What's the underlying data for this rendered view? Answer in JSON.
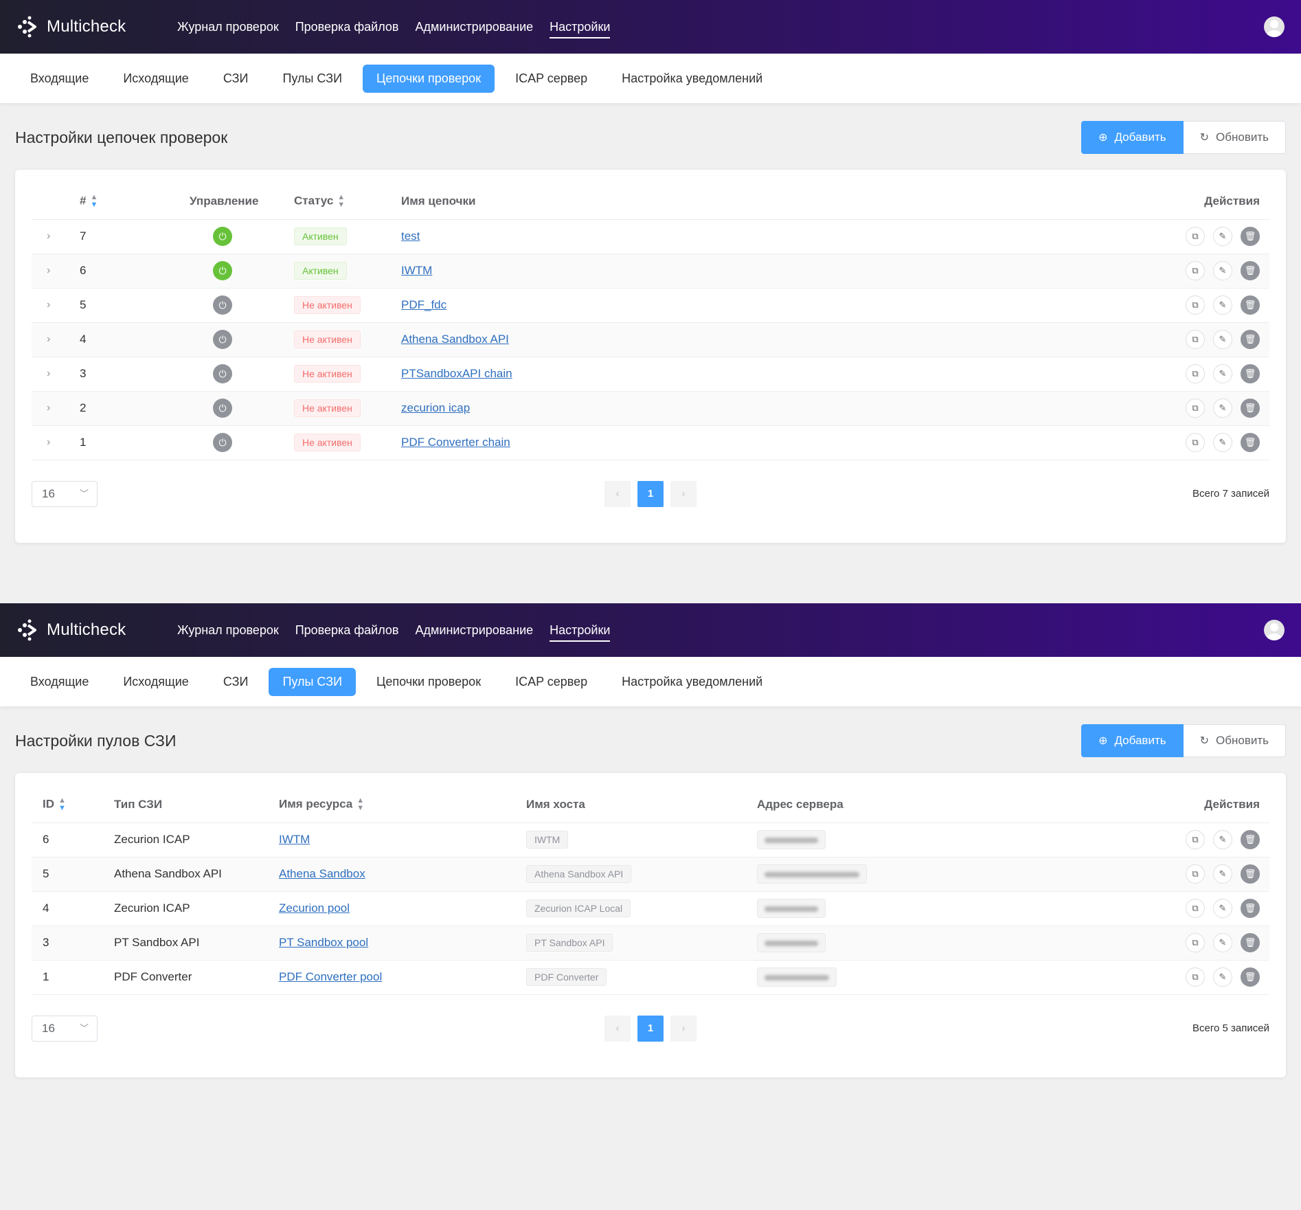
{
  "app": {
    "name": "Multicheck",
    "nav": [
      "Журнал проверок",
      "Проверка файлов",
      "Администрирование",
      "Настройки"
    ],
    "subnav": [
      "Входящие",
      "Исходящие",
      "СЗИ",
      "Пулы СЗИ",
      "Цепочки проверок",
      "ICAP сервер",
      "Настройка уведомлений"
    ],
    "add_label": "Добавить",
    "refresh_label": "Обновить"
  },
  "chains": {
    "active_tab": "Цепочки проверок",
    "title": "Настройки цепочек проверок",
    "columns": [
      "#",
      "Управление",
      "Статус",
      "Имя цепочки",
      "Действия"
    ],
    "rows": [
      {
        "id": "7",
        "enabled": true,
        "status": "Активен",
        "name": "test"
      },
      {
        "id": "6",
        "enabled": true,
        "status": "Активен",
        "name": "IWTM"
      },
      {
        "id": "5",
        "enabled": false,
        "status": "Не активен",
        "name": "PDF_fdc"
      },
      {
        "id": "4",
        "enabled": false,
        "status": "Не активен",
        "name": "Athena Sandbox API"
      },
      {
        "id": "3",
        "enabled": false,
        "status": "Не активен",
        "name": "PTSandboxAPI chain"
      },
      {
        "id": "2",
        "enabled": false,
        "status": "Не активен",
        "name": "zecurion icap"
      },
      {
        "id": "1",
        "enabled": false,
        "status": "Не активен",
        "name": "PDF Converter chain"
      }
    ],
    "page_size": "16",
    "current_page": "1",
    "total": "Всего 7 записей"
  },
  "pools": {
    "active_tab": "Пулы СЗИ",
    "title": "Настройки пулов СЗИ",
    "columns": [
      "ID",
      "Тип СЗИ",
      "Имя ресурса",
      "Имя хоста",
      "Адрес сервера",
      "Действия"
    ],
    "rows": [
      {
        "id": "6",
        "type": "Zecurion ICAP",
        "resource": "IWTM",
        "host": "IWTM"
      },
      {
        "id": "5",
        "type": "Athena Sandbox API",
        "resource": "Athena Sandbox",
        "host": "Athena Sandbox API"
      },
      {
        "id": "4",
        "type": "Zecurion ICAP",
        "resource": "Zecurion pool",
        "host": "Zecurion ICAP Local"
      },
      {
        "id": "3",
        "type": "PT Sandbox API",
        "resource": "PT Sandbox pool",
        "host": "PT Sandbox API"
      },
      {
        "id": "1",
        "type": "PDF Converter",
        "resource": "PDF Converter pool",
        "host": "PDF Converter"
      }
    ],
    "page_size": "16",
    "current_page": "1",
    "total": "Всего 5 записей"
  },
  "colors": {
    "header_start": "#1f1f2e",
    "header_end": "#3d0b8c",
    "primary": "#409eff",
    "active_green": "#67c23a",
    "inactive_red": "#f56c6c"
  },
  "icons": {
    "logo": "multicheck-logo-icon",
    "avatar": "user-avatar-icon",
    "add": "plus-circle-icon",
    "refresh": "refresh-icon",
    "expand": "chevron-right-icon",
    "power": "power-icon",
    "copy": "copy-icon",
    "edit": "edit-icon",
    "delete": "trash-icon"
  }
}
